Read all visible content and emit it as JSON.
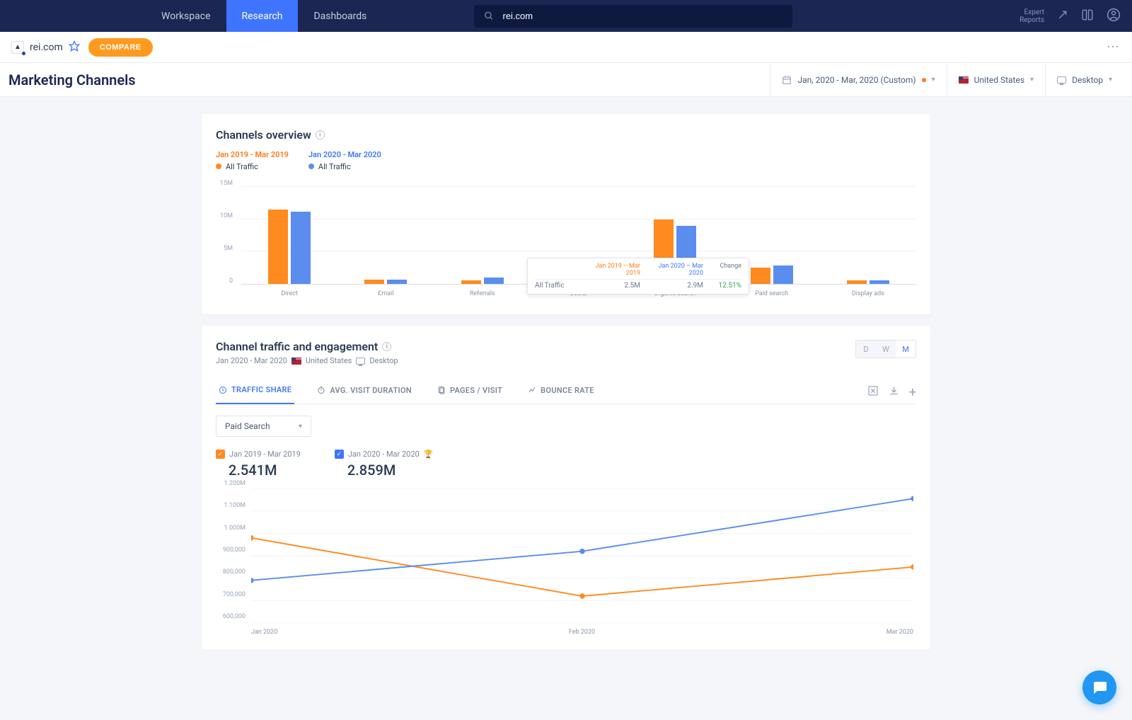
{
  "nav": {
    "tabs": [
      "Workspace",
      "Research",
      "Dashboards"
    ],
    "active_tab": 1,
    "search_value": "rei.com",
    "expert_reports": "Expert\nReports"
  },
  "subnav": {
    "site": "rei.com",
    "compare": "COMPARE"
  },
  "page": {
    "title": "Marketing Channels",
    "date_range": "Jan, 2020 - Mar, 2020 (Custom)",
    "country": "United States",
    "device": "Desktop"
  },
  "overview": {
    "title": "Channels overview",
    "legend": [
      {
        "range": "Jan 2019 - Mar 2019",
        "label": "All Traffic",
        "color": "#ff8a1f"
      },
      {
        "range": "Jan 2020 - Mar 2020",
        "label": "All Traffic",
        "color": "#5b8def"
      }
    ],
    "tooltip": {
      "h_orange": "Jan 2019 – Mar 2019",
      "h_blue": "Jan 2020 – Mar 2020",
      "h_change": "Change",
      "row_label": "All Traffic",
      "v1": "2.5M",
      "v2": "2.9M",
      "change": "12.51%"
    }
  },
  "engagement": {
    "title": "Channel traffic and engagement",
    "sub_range": "Jan 2020 - Mar 2020",
    "sub_country": "United States",
    "sub_device": "Desktop",
    "granularity": [
      "D",
      "W",
      "M"
    ],
    "granularity_active": 2,
    "tabs": [
      "TRAFFIC SHARE",
      "AVG. VISIT DURATION",
      "PAGES / VISIT",
      "BOUNCE RATE"
    ],
    "active_tab": 0,
    "dropdown": "Paid Search",
    "series": [
      {
        "range": "Jan 2019 - Mar 2019",
        "value": "2.541M",
        "color": "orange"
      },
      {
        "range": "Jan 2020 - Mar 2020",
        "value": "2.859M",
        "color": "blue",
        "winner": true
      }
    ]
  },
  "chart_data": [
    {
      "type": "bar",
      "title": "Channels overview",
      "categories": [
        "Direct",
        "Email",
        "Referrals",
        "Social",
        "Organic search",
        "Paid search",
        "Display ads"
      ],
      "series": [
        {
          "name": "Jan 2019 - Mar 2019",
          "color": "#ff8a1f",
          "values": [
            11.5,
            0.7,
            0.6,
            0.5,
            10.0,
            2.5,
            0.5
          ]
        },
        {
          "name": "Jan 2020 - Mar 2020",
          "color": "#5b8def",
          "values": [
            11.2,
            0.7,
            1.0,
            0.5,
            9.0,
            2.9,
            0.5
          ]
        }
      ],
      "ylabel": "",
      "ylim": [
        0,
        15
      ],
      "y_ticks": [
        "0",
        "5M",
        "10M",
        "15M"
      ]
    },
    {
      "type": "line",
      "title": "Traffic Share — Paid Search",
      "x": [
        "Jan 2020",
        "Feb 2020",
        "Mar 2020"
      ],
      "series": [
        {
          "name": "Jan 2019 - Mar 2019",
          "color": "#ff8a1f",
          "values": [
            980000,
            720000,
            850000
          ]
        },
        {
          "name": "Jan 2020 - Mar 2020",
          "color": "#5b8def",
          "values": [
            790000,
            920000,
            1155000
          ]
        }
      ],
      "ylim": [
        600000,
        1200000
      ],
      "y_ticks": [
        "600,000",
        "700,000",
        "800,000",
        "900,000",
        "1.000M",
        "1.100M",
        "1.200M"
      ]
    }
  ]
}
